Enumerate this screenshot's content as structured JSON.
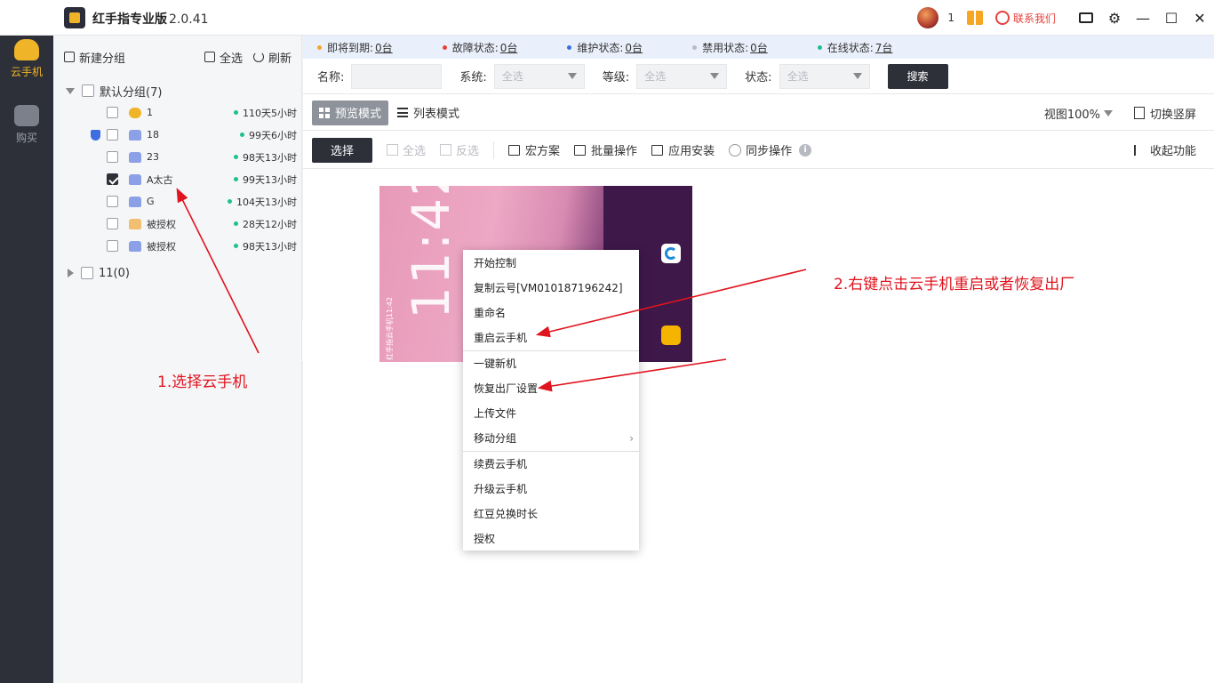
{
  "app": {
    "title": "红手指专业版",
    "version": "2.0.41"
  },
  "titlebar": {
    "message_count": "1",
    "contact_label": "联系我们"
  },
  "nav": {
    "items": [
      {
        "label": "云手机"
      },
      {
        "label": "购买"
      }
    ]
  },
  "sidebar": {
    "new_group": "新建分组",
    "select_all": "全选",
    "refresh": "刷新",
    "groups": [
      {
        "label": "默认分组(7)",
        "expanded": true
      },
      {
        "label": "11(0)",
        "expanded": false
      }
    ],
    "devices": [
      {
        "name": "1",
        "os": "apple",
        "time": "110天5小时",
        "checked": false
      },
      {
        "name": "18",
        "os": "android",
        "time": "99天6小时",
        "checked": false,
        "shield": true
      },
      {
        "name": "23",
        "os": "android",
        "time": "98天13小时",
        "checked": false
      },
      {
        "name": "A太古",
        "os": "android",
        "time": "99天13小时",
        "checked": true
      },
      {
        "name": "G",
        "os": "android",
        "time": "104天13小时",
        "checked": false
      },
      {
        "name": "被授权",
        "os": "android-auth",
        "time": "28天12小时",
        "checked": false
      },
      {
        "name": "被授权",
        "os": "android",
        "time": "98天13小时",
        "checked": false
      }
    ]
  },
  "status": [
    {
      "label": "即将到期:",
      "value": "0台",
      "color": "#f5a623"
    },
    {
      "label": "故障状态:",
      "value": "0台",
      "color": "#e8413c"
    },
    {
      "label": "维护状态:",
      "value": "0台",
      "color": "#3d6ee0"
    },
    {
      "label": "禁用状态:",
      "value": "0台",
      "color": "#b7bac1"
    },
    {
      "label": "在线状态:",
      "value": "7台",
      "color": "#1cc28c"
    }
  ],
  "filter": {
    "name_label": "名称:",
    "system_label": "系统:",
    "system_value": "全选",
    "level_label": "等级:",
    "level_value": "全选",
    "state_label": "状态:",
    "state_value": "全选",
    "search": "搜索"
  },
  "view": {
    "preview_mode": "预览模式",
    "list_mode": "列表模式",
    "zoom": "视图100%",
    "switch_portrait": "切换竖屏"
  },
  "ops": {
    "select": "选择",
    "select_all": "全选",
    "invert": "反选",
    "macro": "宏方案",
    "batch": "批量操作",
    "install": "应用安装",
    "sync": "同步操作",
    "collapse": "收起功能"
  },
  "phone": {
    "clock": "11:42",
    "label": "红手指云手机11:42"
  },
  "context_menu": [
    [
      "开始控制",
      "复制云号[VM010187196242]",
      "重命名",
      "重启云手机"
    ],
    [
      "一键新机",
      "恢复出厂设置",
      "上传文件",
      "移动分组"
    ],
    [
      "续费云手机",
      "升级云手机",
      "红豆兑换时长",
      "授权"
    ]
  ],
  "annotations": {
    "step1": "1.选择云手机",
    "step2": "2.右键点击云手机重启或者恢复出厂"
  }
}
